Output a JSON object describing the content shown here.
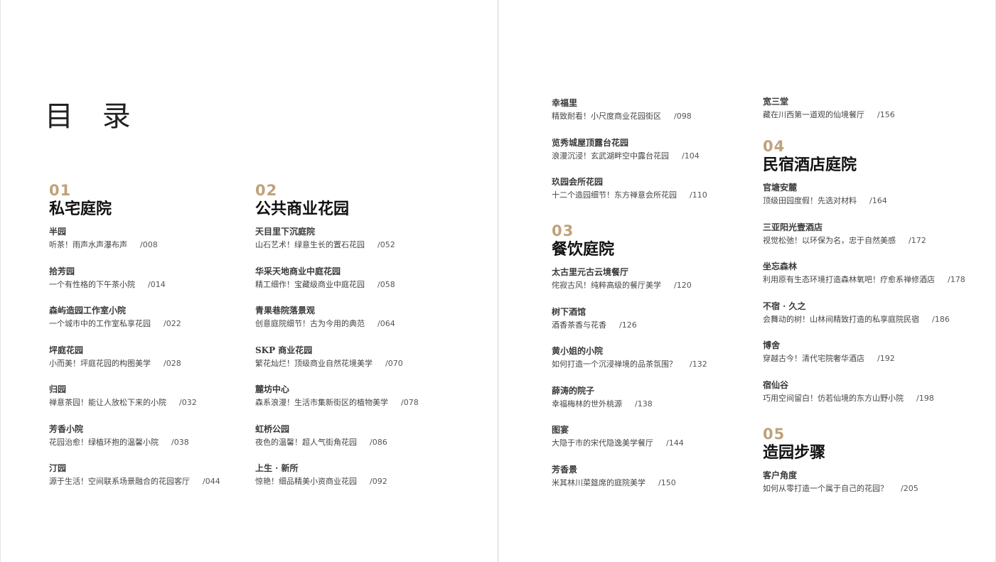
{
  "toc_title": "目 录",
  "sections": {
    "s01": {
      "num": "01",
      "title": "私宅庭院",
      "entries": [
        {
          "title": "半园",
          "desc": "听茶！雨声水声瀑布声",
          "page": "/008"
        },
        {
          "title": "拾芳园",
          "desc": "一个有性格的下午茶小院",
          "page": "/014"
        },
        {
          "title": "森屿造园工作室小院",
          "desc": "一个城市中的工作室私享花园",
          "page": "/022"
        },
        {
          "title": "坪庭花园",
          "desc": "小而美！坪庭花园的构图美学",
          "page": "/028"
        },
        {
          "title": "归园",
          "desc": "禅意茶园！能让人放松下来的小院",
          "page": "/032"
        },
        {
          "title": "芳香小院",
          "desc": "花园治愈！绿植环抱的温馨小院",
          "page": "/038"
        },
        {
          "title": "汀园",
          "desc": "源于生活！空间联系场景融合的花园客厅",
          "page": "/044"
        }
      ]
    },
    "s02": {
      "num": "02",
      "title": "公共商业花园",
      "entries": [
        {
          "title": "天目里下沉庭院",
          "desc": "山石艺术！绿意生长的置石花园",
          "page": "/052"
        },
        {
          "title": "华采天地商业中庭花园",
          "desc": "精工细作！宝藏级商业中庭花园",
          "page": "/058"
        },
        {
          "title": "青果巷院落景观",
          "desc": "创意庭院细节！古为今用的典范",
          "page": "/064"
        },
        {
          "title": "SKP 商业花园",
          "desc": "繁花灿烂！顶级商业自然花境美学",
          "page": "/070"
        },
        {
          "title": "麓坊中心",
          "desc": "森系浪漫！生活市集新街区的植物美学",
          "page": "/078"
        },
        {
          "title": "虹桥公园",
          "desc": "夜色的温馨！超人气街角花园",
          "page": "/086"
        },
        {
          "title": "上生 · 新所",
          "desc": "惊艳！细品精美小资商业花园",
          "page": "/092"
        }
      ]
    },
    "s02_cont": {
      "entries": [
        {
          "title": "幸福里",
          "desc": "精致耐看！小尺度商业花园街区",
          "page": "/098"
        },
        {
          "title": "览秀城屋顶露台花园",
          "desc": "浪漫沉浸！玄武湖畔空中露台花园",
          "page": "/104"
        },
        {
          "title": "玖园会所花园",
          "desc": "十二个造园细节！东方禅意会所花园",
          "page": "/110"
        }
      ]
    },
    "s03": {
      "num": "03",
      "title": "餐饮庭院",
      "entries": [
        {
          "title": "太古里元古云境餐厅",
          "desc": "侘寂古风！纯粹高级的餐厅美学",
          "page": "/120"
        },
        {
          "title": "树下酒馆",
          "desc": "酒香茶香与花香",
          "page": "/126"
        },
        {
          "title": "黄小姐的小院",
          "desc": "如何打造一个沉浸禅境的品茶氛围？",
          "page": "/132"
        },
        {
          "title": "薛涛的院子",
          "desc": "幸福梅林的世外桃源",
          "page": "/138"
        },
        {
          "title": "图宴",
          "desc": "大隐于市的宋代隐逸美学餐厅",
          "page": "/144"
        },
        {
          "title": "芳香景",
          "desc": "米其林川菜筵席的庭院美学",
          "page": "/150"
        }
      ]
    },
    "s03_cont": {
      "entries": [
        {
          "title": "宽三堂",
          "desc": "藏在川西第一道观的仙境餐厅",
          "page": "/156"
        }
      ]
    },
    "s04": {
      "num": "04",
      "title": "民宿酒店庭院",
      "entries": [
        {
          "title": "官塘安麓",
          "desc": "顶级田园度假！先选对材料",
          "page": "/164"
        },
        {
          "title": "三亚阳光壹酒店",
          "desc": "视觉松弛！以环保为名，忠于自然美感",
          "page": "/172"
        },
        {
          "title": "坐忘森林",
          "desc": "利用原有生态环境打造森林氧吧！疗愈系禅修酒店",
          "page": "/178"
        },
        {
          "title": "不宿 · 久之",
          "desc": "会舞动的树！山林间精致打造的私享庭院民宿",
          "page": "/186"
        },
        {
          "title": "博舍",
          "desc": "穿越古今！清代宅院奢华酒店",
          "page": "/192"
        },
        {
          "title": "宿仙谷",
          "desc": "巧用空间留白！仿若仙境的东方山野小院",
          "page": "/198"
        }
      ]
    },
    "s05": {
      "num": "05",
      "title": "造园步骤",
      "entries": [
        {
          "title": "客户角度",
          "desc": "如何从零打造一个属于自己的花园？",
          "page": "/205"
        }
      ]
    }
  },
  "colors": {
    "accent": "#bfa27a",
    "heading": "#111111",
    "text": "#444444"
  }
}
